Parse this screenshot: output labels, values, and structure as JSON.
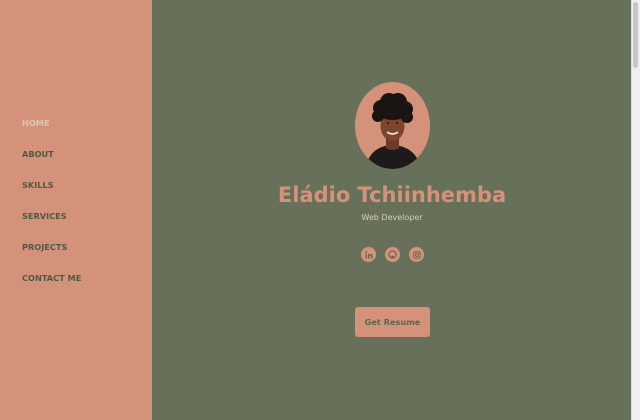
{
  "nav": {
    "items": [
      {
        "label": "HOME",
        "active": true
      },
      {
        "label": "ABOUT",
        "active": false
      },
      {
        "label": "SKILLS",
        "active": false
      },
      {
        "label": "SERVICES",
        "active": false
      },
      {
        "label": "PROJECTS",
        "active": false
      },
      {
        "label": "CONTACT ME",
        "active": false
      }
    ]
  },
  "profile": {
    "name": "Eládio Tchiinhemba",
    "role": "Web Developer"
  },
  "socials": [
    {
      "icon": "linkedin-icon"
    },
    {
      "icon": "github-icon"
    },
    {
      "icon": "instagram-icon"
    }
  ],
  "cta": {
    "label": "Get Resume"
  },
  "colors": {
    "sidebar": "#d39279",
    "main": "#67715a",
    "accent": "#d39279",
    "nav_text": "#4f5a44",
    "nav_active": "#e2c4b5"
  }
}
